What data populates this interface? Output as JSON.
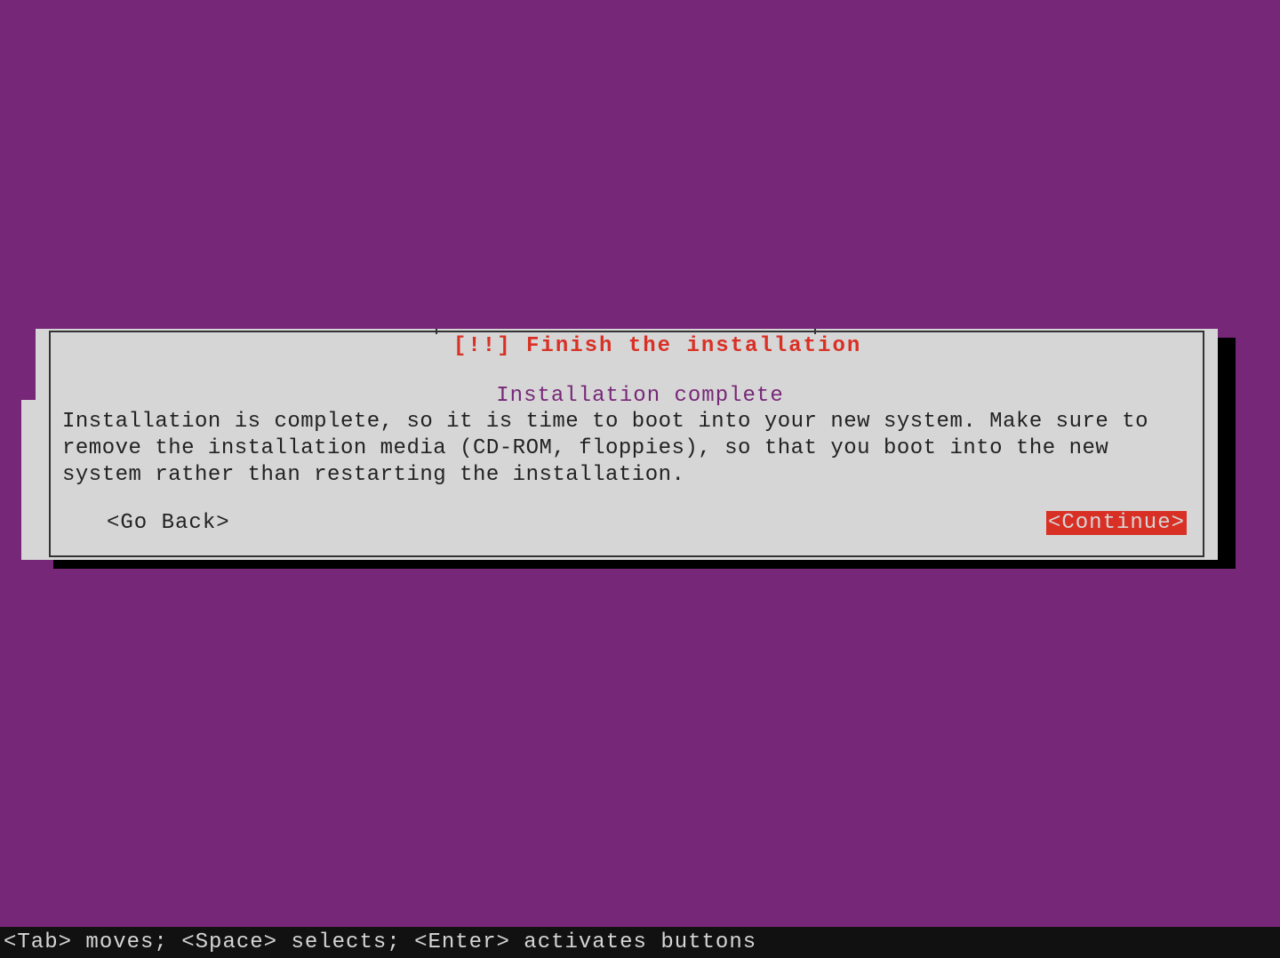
{
  "dialog": {
    "title": "[!!] Finish the installation",
    "subtitle": "Installation complete",
    "body": "Installation is complete, so it is time to boot into your new system. Make sure to remove the installation media (CD-ROM, floppies), so that you boot into the new system rather than restarting the installation.",
    "go_back": "<Go Back>",
    "continue": "<Continue>"
  },
  "help_bar": "<Tab> moves; <Space> selects; <Enter> activates buttons"
}
